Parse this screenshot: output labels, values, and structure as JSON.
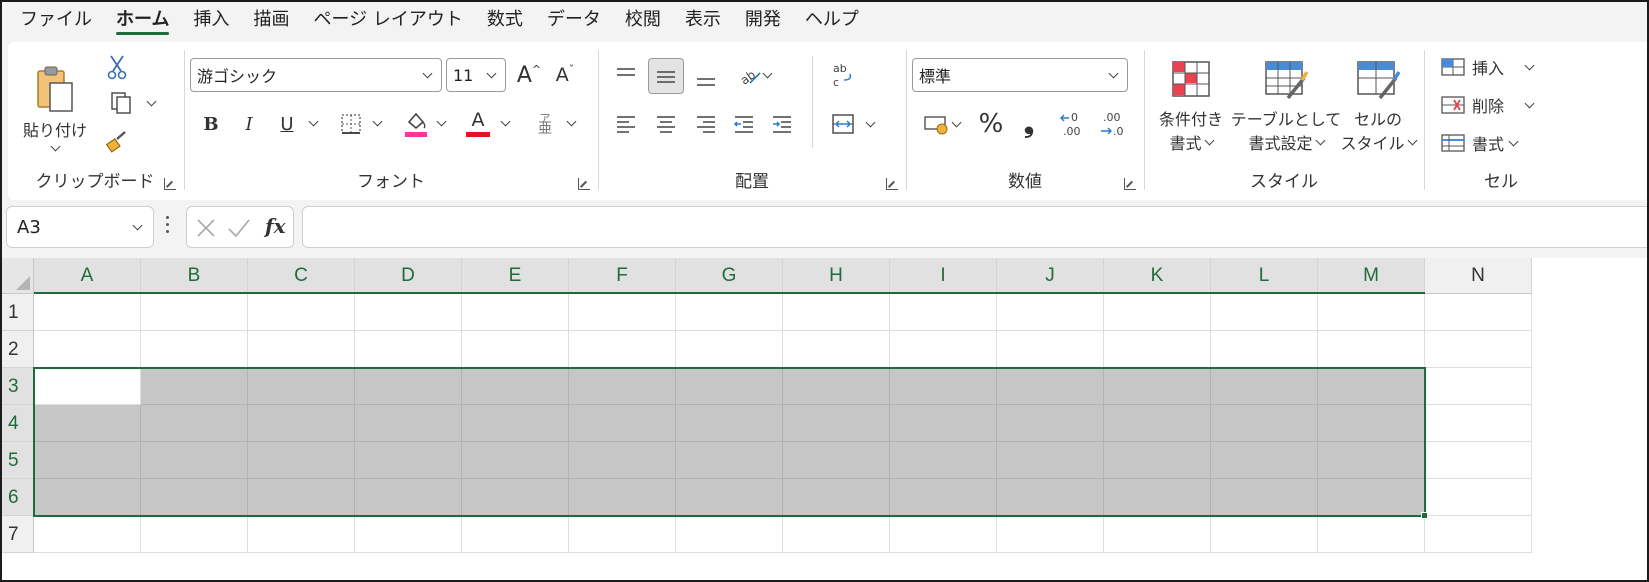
{
  "menu": {
    "tabs": [
      "ファイル",
      "ホーム",
      "挿入",
      "描画",
      "ページ レイアウト",
      "数式",
      "データ",
      "校閲",
      "表示",
      "開発",
      "ヘルプ"
    ],
    "active": "ホーム"
  },
  "clipboard": {
    "paste_label": "貼り付け",
    "group_label": "クリップボード"
  },
  "font": {
    "name": "游ゴシック",
    "size": "11",
    "bold": "B",
    "italic": "I",
    "underline": "U",
    "grow": "A",
    "shrink": "A",
    "color_a": "A",
    "phonetic": "ア",
    "group_label": "フォント",
    "fill_color": "#ff3399",
    "font_color": "#e81123"
  },
  "alignment": {
    "group_label": "配置"
  },
  "number": {
    "format": "標準",
    "percent": "%",
    "comma": "❟",
    "group_label": "数値"
  },
  "styles": {
    "conditional_line1": "条件付き",
    "conditional_line2": "書式",
    "table_line1": "テーブルとして",
    "table_line2": "書式設定",
    "cell_line1": "セルの",
    "cell_line2": "スタイル",
    "group_label": "スタイル"
  },
  "cells": {
    "insert": "挿入",
    "delete": "削除",
    "format": "書式",
    "group_label": "セル"
  },
  "formula_bar": {
    "name_box": "A3",
    "fx": "fx",
    "formula": ""
  },
  "sheet": {
    "columns": [
      "A",
      "B",
      "C",
      "D",
      "E",
      "F",
      "G",
      "H",
      "I",
      "J",
      "K",
      "L",
      "M",
      "N"
    ],
    "rows": [
      "1",
      "2",
      "3",
      "4",
      "5",
      "6",
      "7"
    ],
    "selected_columns": [
      "A",
      "B",
      "C",
      "D",
      "E",
      "F",
      "G",
      "H",
      "I",
      "J",
      "K",
      "L",
      "M"
    ],
    "selected_rows": [
      "3",
      "4",
      "5",
      "6"
    ],
    "active_cell": "A3",
    "selection_color": "#c6c6c6",
    "accent": "#1f6b3d"
  }
}
